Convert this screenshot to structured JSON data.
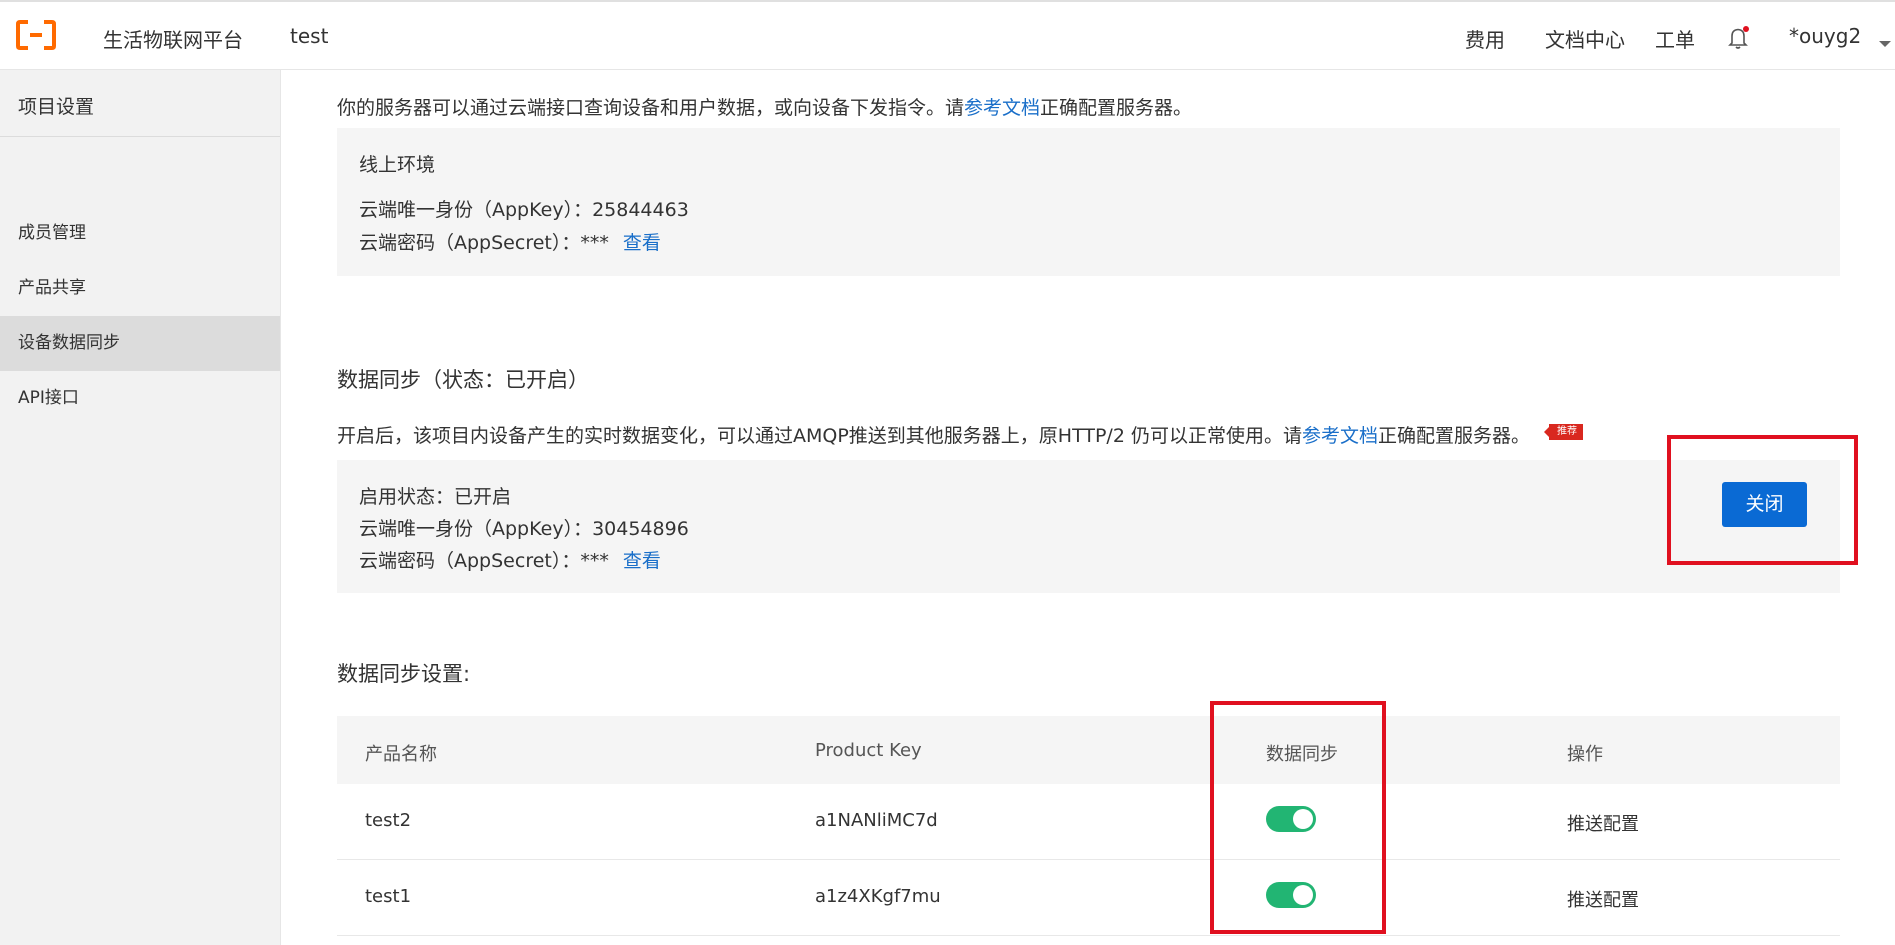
{
  "header": {
    "platform_name": "生活物联网平台",
    "project_name": "test",
    "nav": [
      "费用",
      "文档中心",
      "工单"
    ],
    "user": "*ouyg2"
  },
  "sidebar": {
    "title": "项目设置",
    "items": [
      {
        "label": "成员管理",
        "active": false
      },
      {
        "label": "产品共享",
        "active": false
      },
      {
        "label": "设备数据同步",
        "active": true
      },
      {
        "label": "API接口",
        "active": false
      }
    ]
  },
  "api_section": {
    "intro_prefix": "你的服务器可以通过云端接口查询设备和用户数据，或向设备下发指令。请",
    "intro_link": "参考文档",
    "intro_suffix": "正确配置服务器。",
    "env_title": "线上环境",
    "appkey_label": "云端唯一身份（AppKey）：",
    "appkey_value": "25844463",
    "secret_label": "云端密码（AppSecret）：",
    "secret_value": "***",
    "view_link": "查看"
  },
  "sync_section": {
    "title": "数据同步（状态：已开启）",
    "desc_prefix": "开启后，该项目内设备产生的实时数据变化，可以通过AMQP推送到其他服务器上，原HTTP/2 仍可以正常使用。请",
    "desc_link": "参考文档",
    "desc_suffix": "正确配置服务器。",
    "badge": "推荐",
    "status_line": "启用状态：已开启",
    "appkey_label": "云端唯一身份（AppKey）：",
    "appkey_value": "30454896",
    "secret_label": "云端密码（AppSecret）：",
    "secret_value": "***",
    "view_link": "查看",
    "close_button": "关闭"
  },
  "settings": {
    "title": "数据同步设置:",
    "columns": [
      "产品名称",
      "Product Key",
      "数据同步",
      "操作"
    ],
    "rows": [
      {
        "name": "test2",
        "product_key": "a1NANliMC7d",
        "sync": true,
        "action": "推送配置"
      },
      {
        "name": "test1",
        "product_key": "a1z4XKgf7mu",
        "sync": true,
        "action": "推送配置"
      }
    ]
  },
  "colors": {
    "accent": "#0a6ad4",
    "link": "#1a6fc9",
    "brand": "#ff6a00",
    "toggle_on": "#22b573",
    "highlight": "#e0101f"
  }
}
